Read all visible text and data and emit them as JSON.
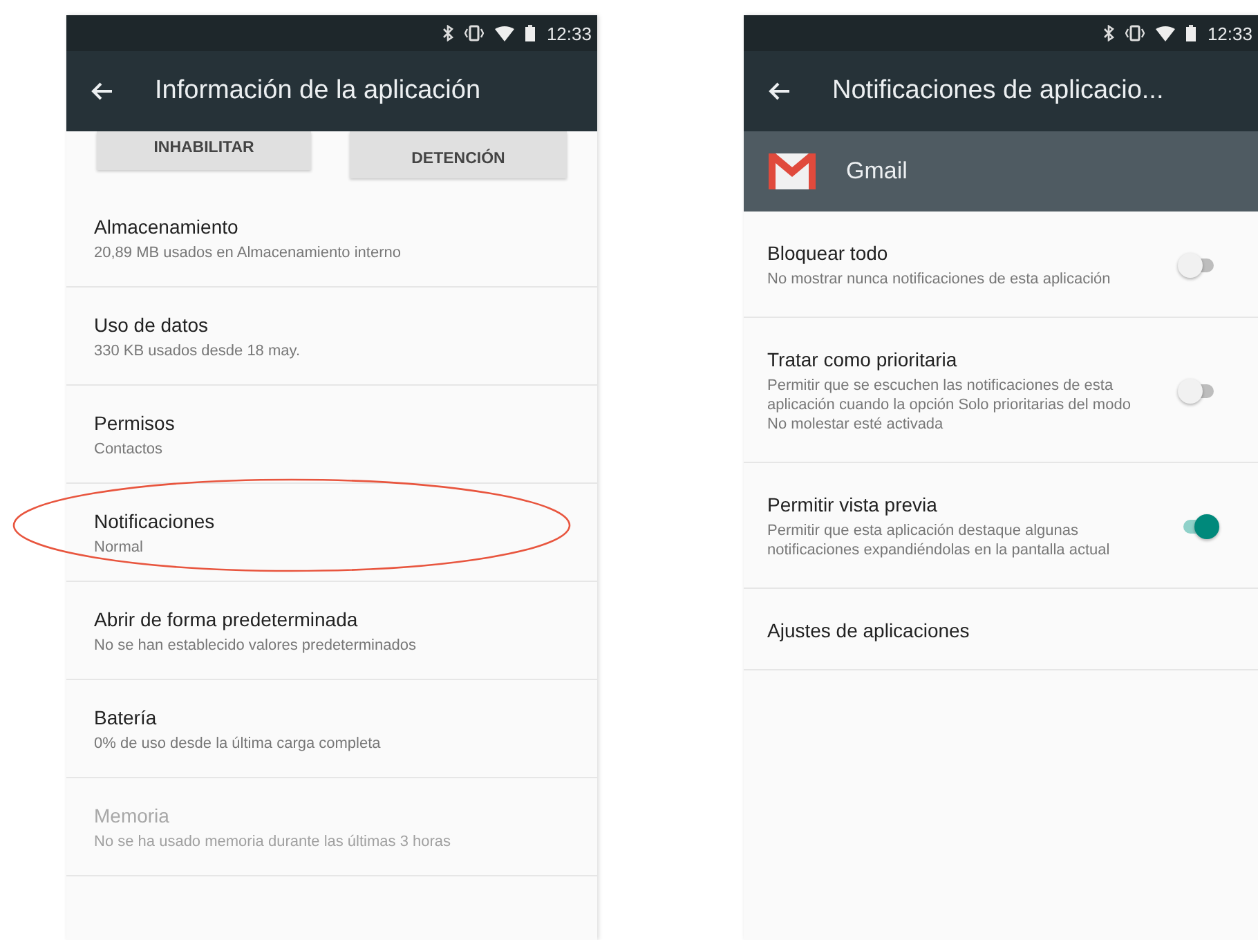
{
  "phones": [
    {
      "status_bar": {
        "time": "12:33"
      },
      "app_bar": {
        "title": "Información de la aplicación"
      },
      "buttons": [
        {
          "label": "INHABILITAR"
        },
        {
          "label": "DETENCIÓN"
        }
      ],
      "items": [
        {
          "title": "Almacenamiento",
          "subtitle": "20,89 MB usados en Almacenamiento interno",
          "disabled": false,
          "highlighted": false
        },
        {
          "title": "Uso de datos",
          "subtitle": "330 KB usados desde 18 may.",
          "disabled": false,
          "highlighted": false
        },
        {
          "title": "Permisos",
          "subtitle": "Contactos",
          "disabled": false,
          "highlighted": false
        },
        {
          "title": "Notificaciones",
          "subtitle": "Normal",
          "disabled": false,
          "highlighted": true
        },
        {
          "title": "Abrir de forma predeterminada",
          "subtitle": "No se han establecido valores predeterminados",
          "disabled": false,
          "highlighted": false
        },
        {
          "title": "Batería",
          "subtitle": "0% de uso desde la última carga completa",
          "disabled": false,
          "highlighted": false
        },
        {
          "title": "Memoria",
          "subtitle": "No se ha usado memoria durante las últimas 3 horas",
          "disabled": true,
          "highlighted": false
        }
      ]
    },
    {
      "status_bar": {
        "time": "12:33"
      },
      "app_bar": {
        "title": "Notificaciones de aplicacio..."
      },
      "app_header": {
        "name": "Gmail"
      },
      "items": [
        {
          "title": "Bloquear todo",
          "subtitle": "No mostrar nunca notificaciones de esta aplicación",
          "on": false
        },
        {
          "title": "Tratar como prioritaria",
          "subtitle": "Permitir que se escuchen las notificaciones de esta aplicación cuando la opción Solo prioritarias del modo No molestar esté activada",
          "on": false
        },
        {
          "title": "Permitir vista previa",
          "subtitle": "Permitir que esta aplicación destaque algunas notificaciones expandiéndolas en la pantalla actual",
          "on": true
        },
        {
          "title": "Ajustes de aplicaciones"
        }
      ]
    }
  ]
}
